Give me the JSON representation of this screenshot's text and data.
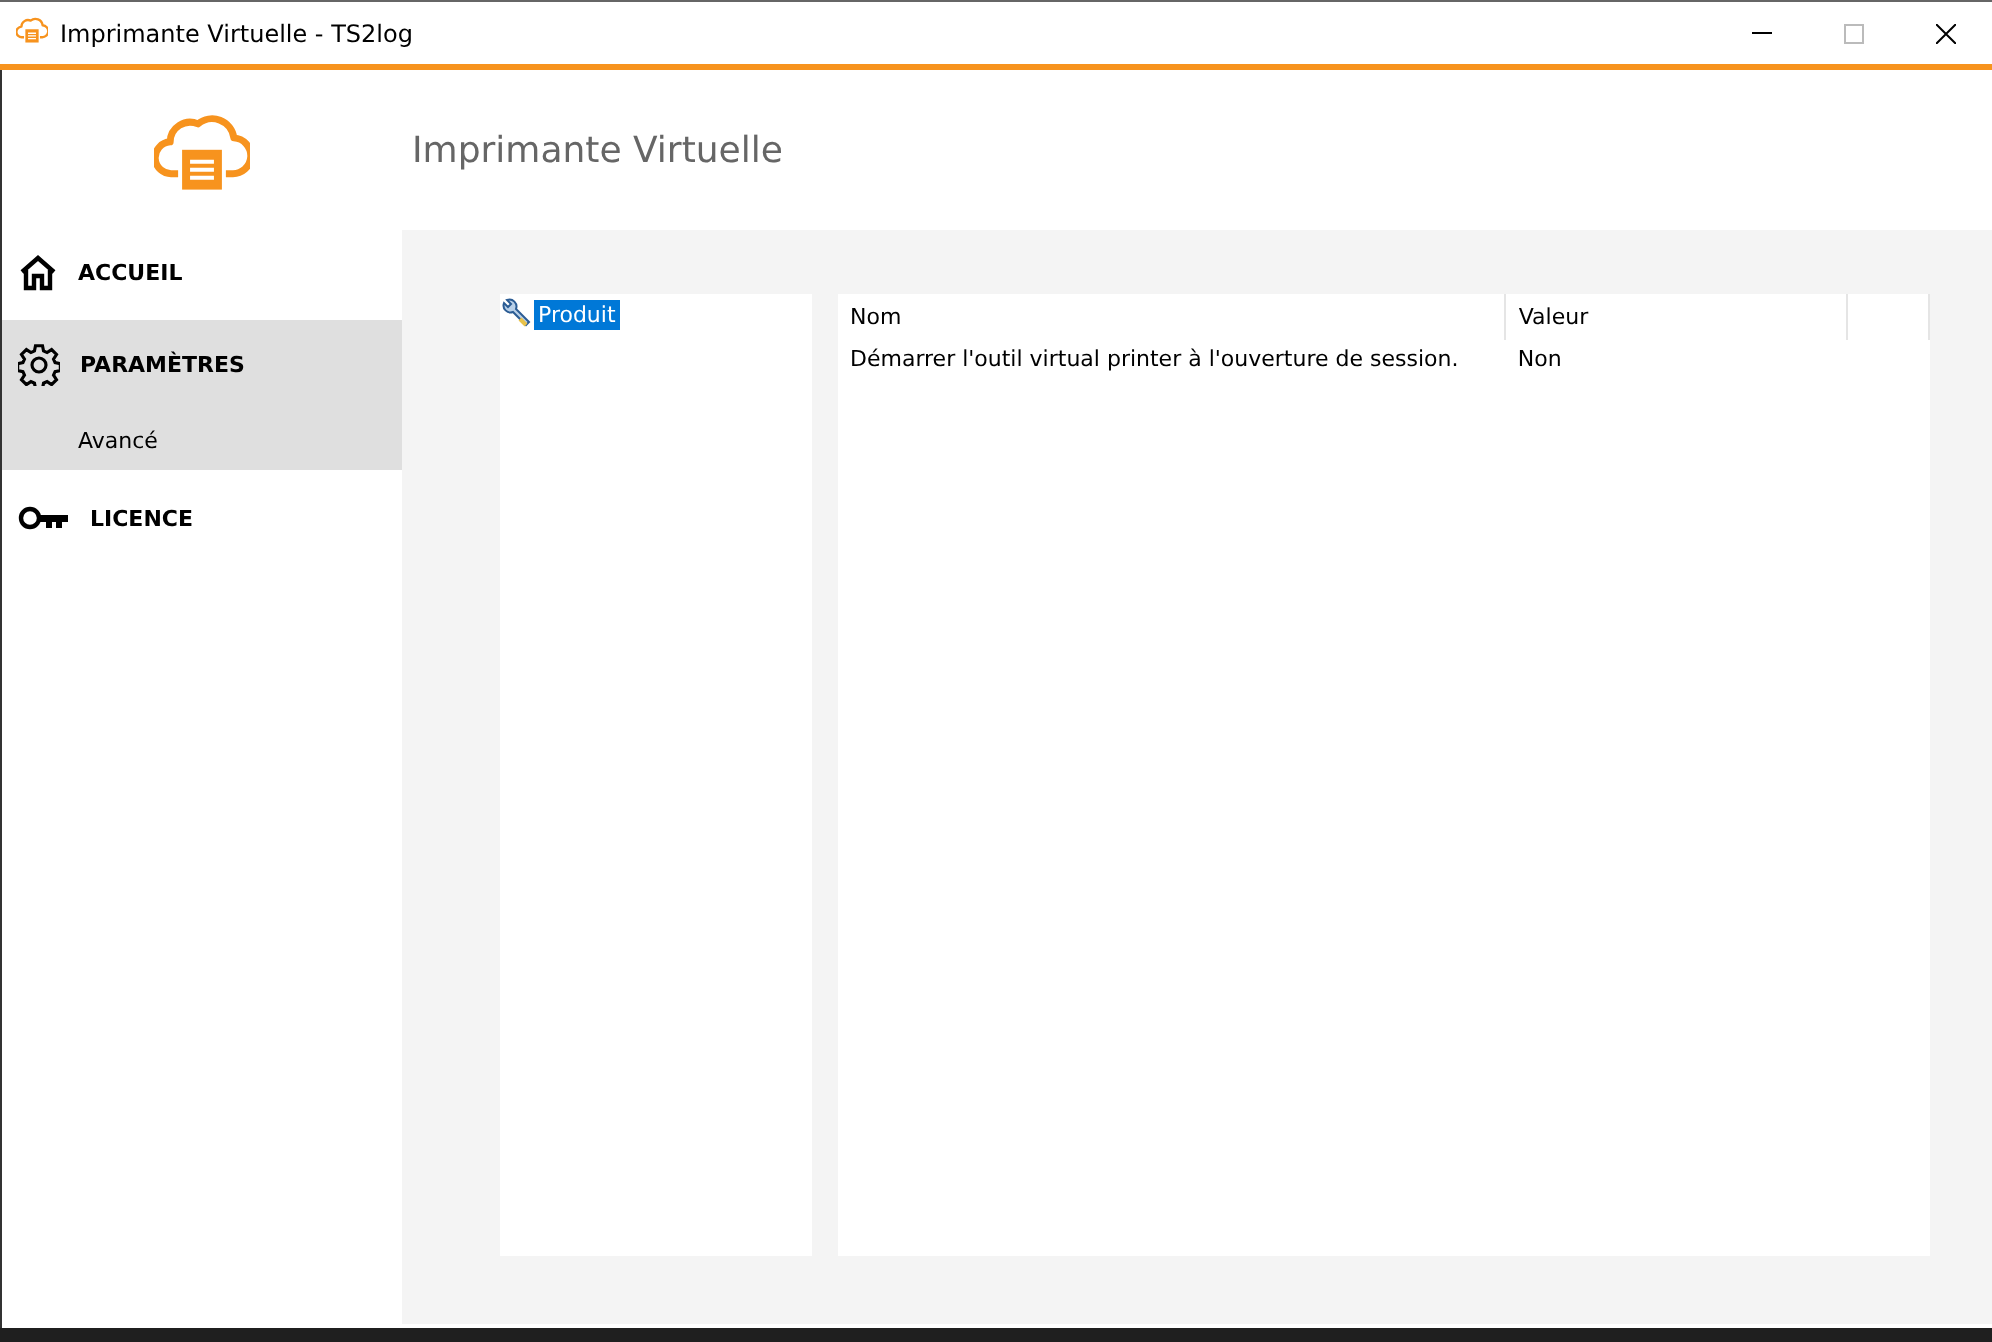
{
  "window": {
    "title": "Imprimante Virtuelle - TS2log"
  },
  "header": {
    "title": "Imprimante Virtuelle"
  },
  "sidebar": {
    "items": [
      {
        "label": "ACCUEIL",
        "kind": "home",
        "selected": false
      },
      {
        "label": "PARAMÈTRES",
        "kind": "settings",
        "selected": true,
        "children": [
          {
            "label": "Avancé",
            "selected": false
          }
        ]
      },
      {
        "label": "LICENCE",
        "kind": "license",
        "selected": false
      }
    ]
  },
  "tree": {
    "items": [
      {
        "label": "Produit",
        "selected": true
      }
    ]
  },
  "table": {
    "columns": [
      "Nom",
      "Valeur"
    ],
    "rows": [
      [
        "Démarrer l'outil virtual printer à l'ouverture de session.",
        "Non"
      ]
    ]
  }
}
